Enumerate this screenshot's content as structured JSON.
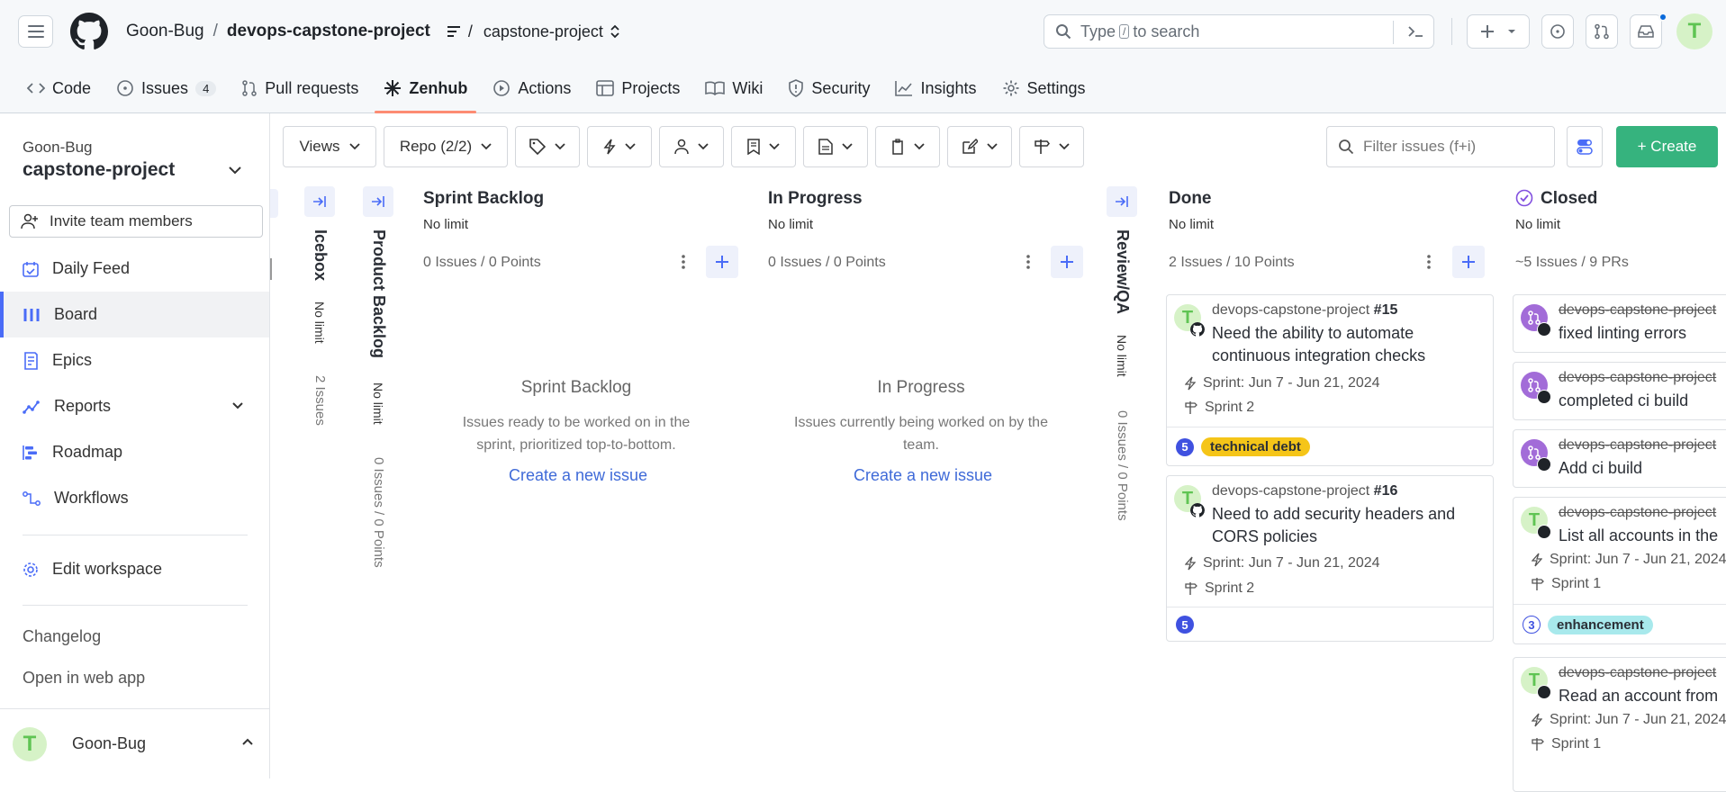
{
  "header": {
    "owner": "Goon-Bug",
    "repo": "devops-capstone-project",
    "branch_icon_sep": "/",
    "project": "capstone-project",
    "search_prefix": "Type",
    "search_kbd": "/",
    "search_suffix": "to search",
    "avatar_letter": "T"
  },
  "tabs": [
    {
      "label": "Code",
      "icon": "code-icon"
    },
    {
      "label": "Issues",
      "icon": "issue-icon",
      "count": "4"
    },
    {
      "label": "Pull requests",
      "icon": "pull-request-icon"
    },
    {
      "label": "Zenhub",
      "icon": "zenhub-icon"
    },
    {
      "label": "Actions",
      "icon": "play-icon"
    },
    {
      "label": "Projects",
      "icon": "table-icon"
    },
    {
      "label": "Wiki",
      "icon": "book-icon"
    },
    {
      "label": "Security",
      "icon": "shield-icon"
    },
    {
      "label": "Insights",
      "icon": "graph-icon"
    },
    {
      "label": "Settings",
      "icon": "gear-icon"
    }
  ],
  "sidebar": {
    "owner": "Goon-Bug",
    "workspace": "capstone-project",
    "invite": "Invite team members",
    "items": [
      {
        "label": "Daily Feed"
      },
      {
        "label": "Board"
      },
      {
        "label": "Epics"
      },
      {
        "label": "Reports"
      },
      {
        "label": "Roadmap"
      },
      {
        "label": "Workflows"
      }
    ],
    "edit": "Edit workspace",
    "changelog": "Changelog",
    "open_web": "Open in web app",
    "user": "Goon-Bug"
  },
  "toolbar": {
    "views": "Views",
    "repo": "Repo (2/2)",
    "filter_placeholder": "Filter issues (f+i)",
    "create": "+ Create"
  },
  "pipelines": {
    "icebox": {
      "title": "Icebox",
      "limit": "No limit",
      "count": "2 Issues"
    },
    "product_backlog": {
      "title": "Product Backlog",
      "limit": "No limit",
      "count": "0 Issues / 0 Points"
    },
    "sprint_backlog": {
      "title": "Sprint Backlog",
      "limit": "No limit",
      "count": "0 Issues / 0 Points",
      "empty_title": "Sprint Backlog",
      "empty_desc": "Issues ready to be worked on in the sprint, prioritized top-to-bottom.",
      "empty_link": "Create a new issue"
    },
    "in_progress": {
      "title": "In Progress",
      "limit": "No limit",
      "count": "0 Issues / 0 Points",
      "empty_title": "In Progress",
      "empty_desc": "Issues currently being worked on by the team.",
      "empty_link": "Create a new issue"
    },
    "review_qa": {
      "title": "Review/QA",
      "limit": "No limit",
      "count": "0 Issues / 0 Points"
    },
    "done": {
      "title": "Done",
      "limit": "No limit",
      "count": "2 Issues / 10 Points"
    },
    "closed": {
      "title": "Closed",
      "limit": "No limit",
      "count": "~5 Issues / 9 PRs"
    }
  },
  "done_cards": [
    {
      "repo": "devops-capstone-project",
      "num": "#15",
      "title1": "Need the ability to automate",
      "title2": "continuous integration checks",
      "sprint": "Sprint: Jun 7 - Jun 21, 2024",
      "milestone": "Sprint 2",
      "points": "5",
      "label": "technical debt"
    },
    {
      "repo": "devops-capstone-project",
      "num": "#16",
      "title1": "Need to add security headers and",
      "title2": "CORS policies",
      "sprint": "Sprint: Jun 7 - Jun 21, 2024",
      "milestone": "Sprint 2",
      "points": "5"
    }
  ],
  "closed_cards": [
    {
      "repo": "devops-capstone-project",
      "title": "fixed linting errors"
    },
    {
      "repo": "devops-capstone-project",
      "title": "completed ci build"
    },
    {
      "repo": "devops-capstone-project",
      "title": "Add ci build"
    },
    {
      "repo": "devops-capstone-project",
      "title": "List all accounts in the",
      "sprint": "Sprint: Jun 7 - Jun 21, 2024",
      "milestone": "Sprint 1",
      "points": "3",
      "label": "enhancement"
    },
    {
      "repo": "devops-capstone-project",
      "title": "Read an account from",
      "sprint": "Sprint: Jun 7 - Jun 21, 2024",
      "milestone": "Sprint 1"
    }
  ],
  "colors": {
    "accent": "#4a6cf7",
    "create": "#36b37e",
    "tech_debt": "#f5c518",
    "enhancement": "#a8e9ec",
    "active_tab": "#fd8c73"
  }
}
